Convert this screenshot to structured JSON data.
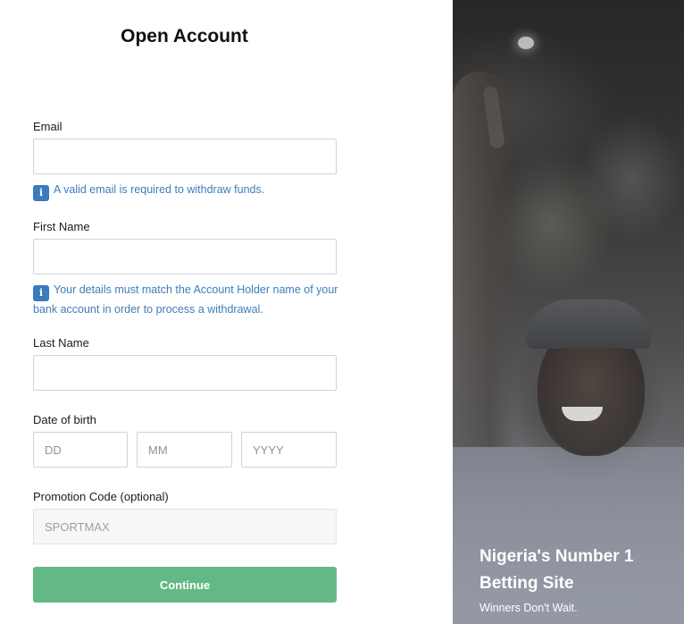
{
  "form": {
    "title": "Open Account",
    "email": {
      "label": "Email",
      "value": "",
      "placeholder": "",
      "hint": "A valid email is required to withdraw funds."
    },
    "first_name": {
      "label": "First Name",
      "value": "",
      "placeholder": "",
      "hint": "Your details must match the Account Holder name of your bank account in order to process a withdrawal."
    },
    "last_name": {
      "label": "Last Name",
      "value": "",
      "placeholder": ""
    },
    "dob": {
      "label": "Date of birth",
      "day_placeholder": "DD",
      "month_placeholder": "MM",
      "year_placeholder": "YYYY"
    },
    "promo": {
      "label": "Promotion Code (optional)",
      "placeholder": "SPORTMAX",
      "disabled": true
    },
    "continue_label": "Continue",
    "info_icon": "info-icon",
    "info_glyph": "i"
  },
  "promo_panel": {
    "headline": "Nigeria's Number 1 Betting Site",
    "tagline": "Winners Don't Wait."
  },
  "colors": {
    "accent_button": "#63b985",
    "hint_text": "#3f7db8",
    "info_icon_bg": "#3a7bbd"
  }
}
